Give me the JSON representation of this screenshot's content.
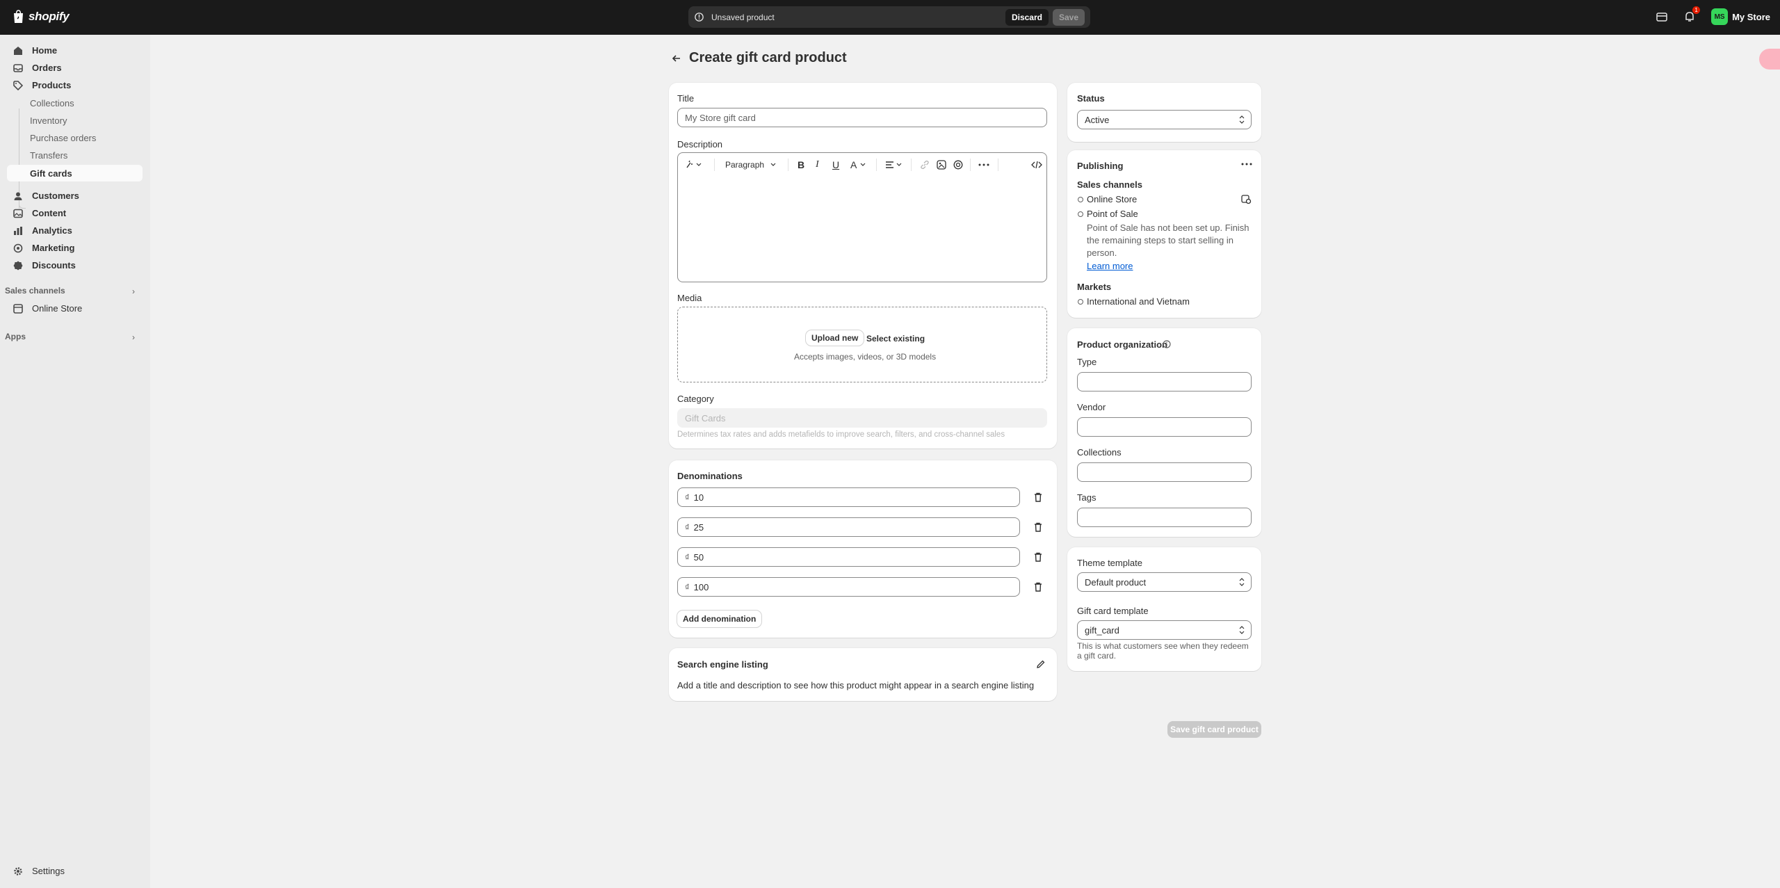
{
  "topbar": {
    "logo_text": "shopify",
    "unsaved_message": "Unsaved product",
    "discard_label": "Discard",
    "save_label": "Save",
    "notification_count": "1",
    "store_initials": "MS",
    "store_name": "My Store"
  },
  "sidebar": {
    "items": [
      {
        "label": "Home",
        "icon": "home-icon"
      },
      {
        "label": "Orders",
        "icon": "inbox-icon"
      },
      {
        "label": "Products",
        "icon": "tag-icon"
      }
    ],
    "product_subitems": [
      "Collections",
      "Inventory",
      "Purchase orders",
      "Transfers",
      "Gift cards"
    ],
    "items2": [
      {
        "label": "Customers",
        "icon": "person-icon"
      },
      {
        "label": "Content",
        "icon": "content-icon"
      },
      {
        "label": "Analytics",
        "icon": "chart-icon"
      },
      {
        "label": "Marketing",
        "icon": "target-icon"
      },
      {
        "label": "Discounts",
        "icon": "discount-icon"
      }
    ],
    "sales_channels_label": "Sales channels",
    "online_store_label": "Online Store",
    "apps_label": "Apps",
    "settings_label": "Settings"
  },
  "page": {
    "title": "Create gift card product"
  },
  "main": {
    "title_label": "Title",
    "title_placeholder": "My Store gift card",
    "description_label": "Description",
    "paragraph_label": "Paragraph",
    "media_label": "Media",
    "upload_new": "Upload new",
    "select_existing": "Select existing",
    "media_help": "Accepts images, videos, or 3D models",
    "category_label": "Category",
    "category_value": "Gift Cards",
    "category_help": "Determines tax rates and adds metafields to improve search, filters, and cross-channel sales"
  },
  "denominations": {
    "heading": "Denominations",
    "currency": "₫",
    "values": [
      "10",
      "25",
      "50",
      "100"
    ],
    "add_label": "Add denomination"
  },
  "seo": {
    "heading": "Search engine listing",
    "text": "Add a title and description to see how this product might appear in a search engine listing"
  },
  "status": {
    "label": "Status",
    "value": "Active"
  },
  "publishing": {
    "heading": "Publishing",
    "sales_channels_label": "Sales channels",
    "channel_online_store": "Online Store",
    "channel_pos": "Point of Sale",
    "pos_message": "Point of Sale has not been set up. Finish the remaining steps to start selling in person.",
    "learn_more": "Learn more",
    "markets_label": "Markets",
    "market_value": "International and Vietnam"
  },
  "organization": {
    "heading": "Product organization",
    "type_label": "Type",
    "vendor_label": "Vendor",
    "collections_label": "Collections",
    "tags_label": "Tags"
  },
  "templates": {
    "theme_label": "Theme template",
    "theme_value": "Default product",
    "giftcard_label": "Gift card template",
    "giftcard_value": "gift_card",
    "giftcard_help": "This is what customers see when they redeem a gift card."
  },
  "footer": {
    "save_label": "Save gift card product"
  }
}
